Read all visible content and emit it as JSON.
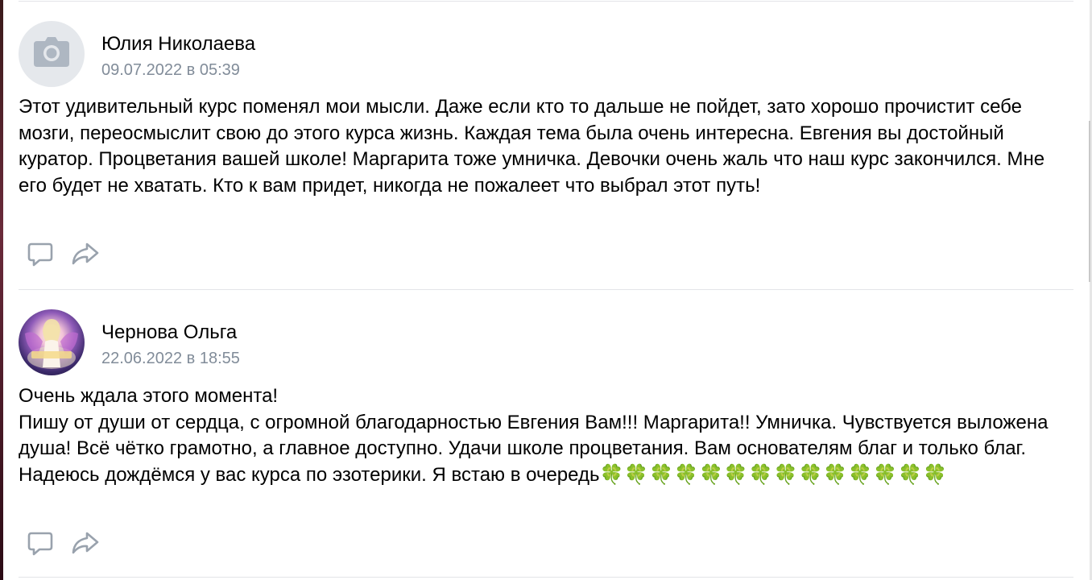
{
  "comments": [
    {
      "author": "Юлия Николаева",
      "date": "09.07.2022 в 05:39",
      "avatar_icon": "camera-icon",
      "lines": [
        "Этот удивительный курс поменял мои мысли. Даже если кто то дальше не пойдет, зато хорошо прочистит себе мозги, переосмыслит свою до этого курса жизнь. Каждая тема была очень интересна. Евгения вы достойный куратор. Процветания вашей школе! Маргарита тоже умничка. Девочки очень жаль что наш курс закончился. Мне его будет не хватать. Кто к вам придет, никогда не пожалеет что выбрал этот путь!"
      ],
      "actions": [
        "reply-icon",
        "share-icon"
      ]
    },
    {
      "author": "Чернова Ольга",
      "date": "22.06.2022 в 18:55",
      "avatar_icon": "user-photo",
      "lines": [
        "Очень ждала этого момента!",
        "Пишу от души от сердца, с огромной благодарностью Евгения Вам!!! Маргарита!! Умничка. Чувствуется выложена душа! Всё чётко грамотно, а главное доступно. Удачи школе процветания. Вам основателям благ и только благ. Надеюсь дождёмся у вас курса по эзотерики. Я встаю в очередь"
      ],
      "clovers": "🍀🍀🍀🍀🍀🍀🍀🍀🍀🍀🍀🍀🍀🍀",
      "actions": [
        "reply-icon",
        "share-icon"
      ]
    }
  ],
  "colors": {
    "date": "#818c99",
    "divider": "#e3e4e8",
    "icon": "#99a2ad",
    "avatar_placeholder": "#e5e8ec",
    "clover": "#2fa34b"
  }
}
